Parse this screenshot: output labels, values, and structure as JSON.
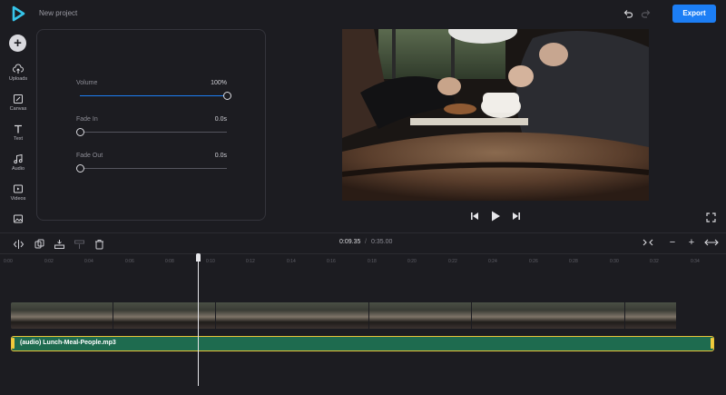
{
  "app": {
    "project_title": "New project",
    "export_label": "Export",
    "accent_color": "#1c7ef5"
  },
  "sidebar": {
    "add_icon": "plus-icon",
    "items": [
      {
        "label": "Uploads",
        "icon": "upload-cloud-icon"
      },
      {
        "label": "Canvas",
        "icon": "canvas-icon"
      },
      {
        "label": "Text",
        "icon": "text-icon"
      },
      {
        "label": "Audio",
        "icon": "music-note-icon"
      },
      {
        "label": "Videos",
        "icon": "video-icon"
      },
      {
        "label": "",
        "icon": "image-icon"
      }
    ]
  },
  "audio_panel": {
    "volume": {
      "label": "Volume",
      "value": "100%",
      "level": 1.0
    },
    "fade_in": {
      "label": "Fade In",
      "value": "0.0s",
      "level": 0.0
    },
    "fade_out": {
      "label": "Fade Out",
      "value": "0.0s",
      "level": 0.0
    }
  },
  "player": {
    "prev_icon": "skip-back-icon",
    "play_icon": "play-icon",
    "next_icon": "skip-forward-icon",
    "fullscreen_icon": "fullscreen-icon"
  },
  "timeline": {
    "current_time": "0:09.35",
    "separator": "/",
    "total_time": "0:35.00",
    "tools": [
      "split-icon",
      "duplicate-icon",
      "audio-detach-icon",
      "layer-icon",
      "delete-icon"
    ],
    "zoom": {
      "fit": "fit-icon",
      "zoom_out": "−",
      "zoom_in": "+",
      "expand": "expand-icon"
    },
    "ruler": [
      "0:00",
      "0:02",
      "0:04",
      "0:06",
      "0:08",
      "0:10",
      "0:12",
      "0:14",
      "0:16",
      "0:18",
      "0:20",
      "0:22",
      "0:24",
      "0:26",
      "0:28",
      "0:30",
      "0:32",
      "0:34"
    ],
    "audio_clip": "(audio) Lunch-Meal-People.mp3",
    "audio_color": "#1e6b4f",
    "selection_color": "#e8c339",
    "playhead_time": "0:09.35"
  }
}
